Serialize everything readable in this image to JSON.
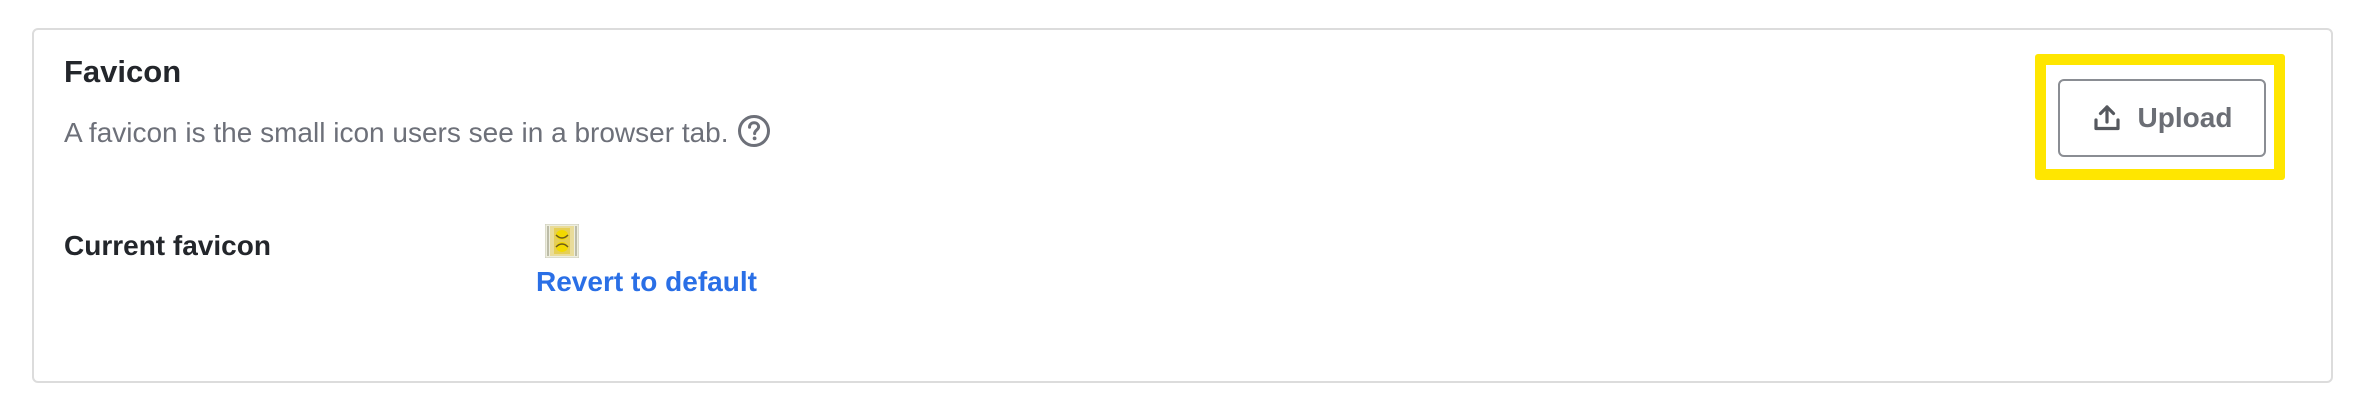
{
  "section": {
    "title": "Favicon",
    "description": "A favicon is the small icon users see in a browser tab.",
    "help_icon": "question-circle-icon"
  },
  "current_favicon": {
    "label": "Current favicon",
    "revert_link": "Revert to default"
  },
  "upload_button": {
    "label": "Upload",
    "icon": "upload-icon"
  },
  "colors": {
    "link": "#2a6fe6",
    "highlight": "#ffe600",
    "border": "#dcdcdc"
  }
}
